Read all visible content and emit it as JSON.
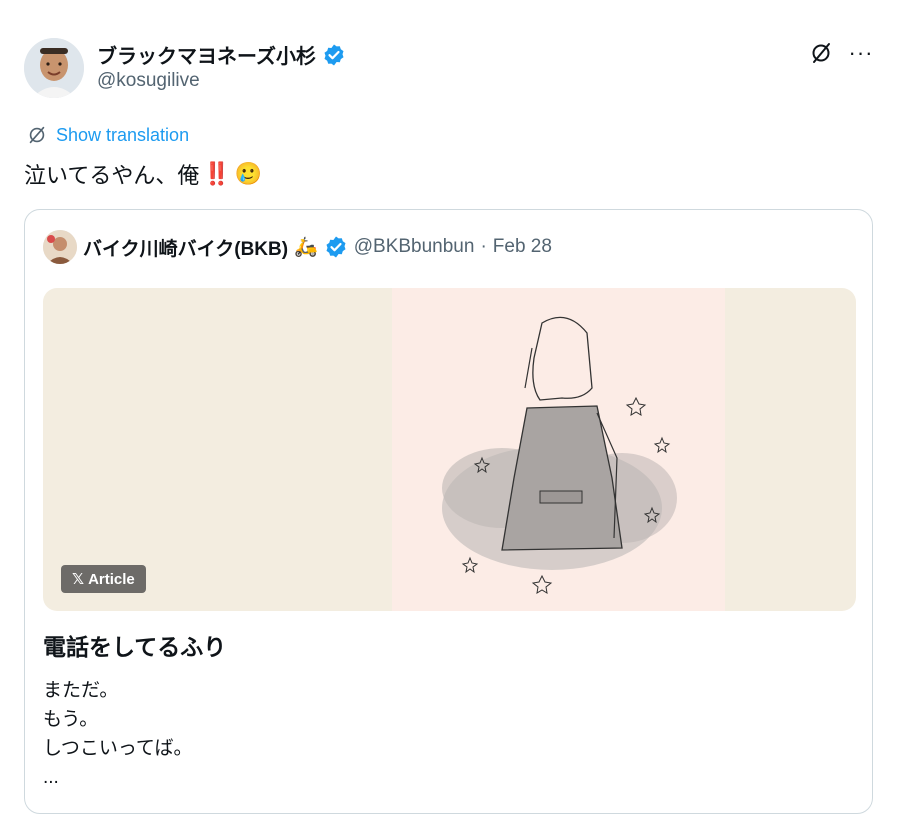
{
  "author": {
    "display_name": "ブラックマヨネーズ小杉",
    "handle": "@kosugilive",
    "verified": true
  },
  "actions": {
    "grok_icon": "slash-circle-icon",
    "more_label": "···"
  },
  "translation": {
    "label": "Show translation"
  },
  "tweet": {
    "text": "泣いてるやん、俺",
    "emoji_1": "‼️",
    "emoji_2": "🥲"
  },
  "quote": {
    "display_name": "バイク川崎バイク(BKB)",
    "name_emoji": "🛵",
    "handle": "@BKBbunbun",
    "separator": "·",
    "date": "Feb 28",
    "badge_label": "Article",
    "title": "電話をしてるふり",
    "lines": [
      "まただ。",
      "もう。",
      "しつこいってば。",
      "..."
    ]
  },
  "colors": {
    "accent": "#1d9bf0",
    "text": "#0f1419",
    "secondary": "#536471",
    "border": "#cfd9de",
    "media_bg": "#f3ede0",
    "media_center": "#fcece6"
  }
}
